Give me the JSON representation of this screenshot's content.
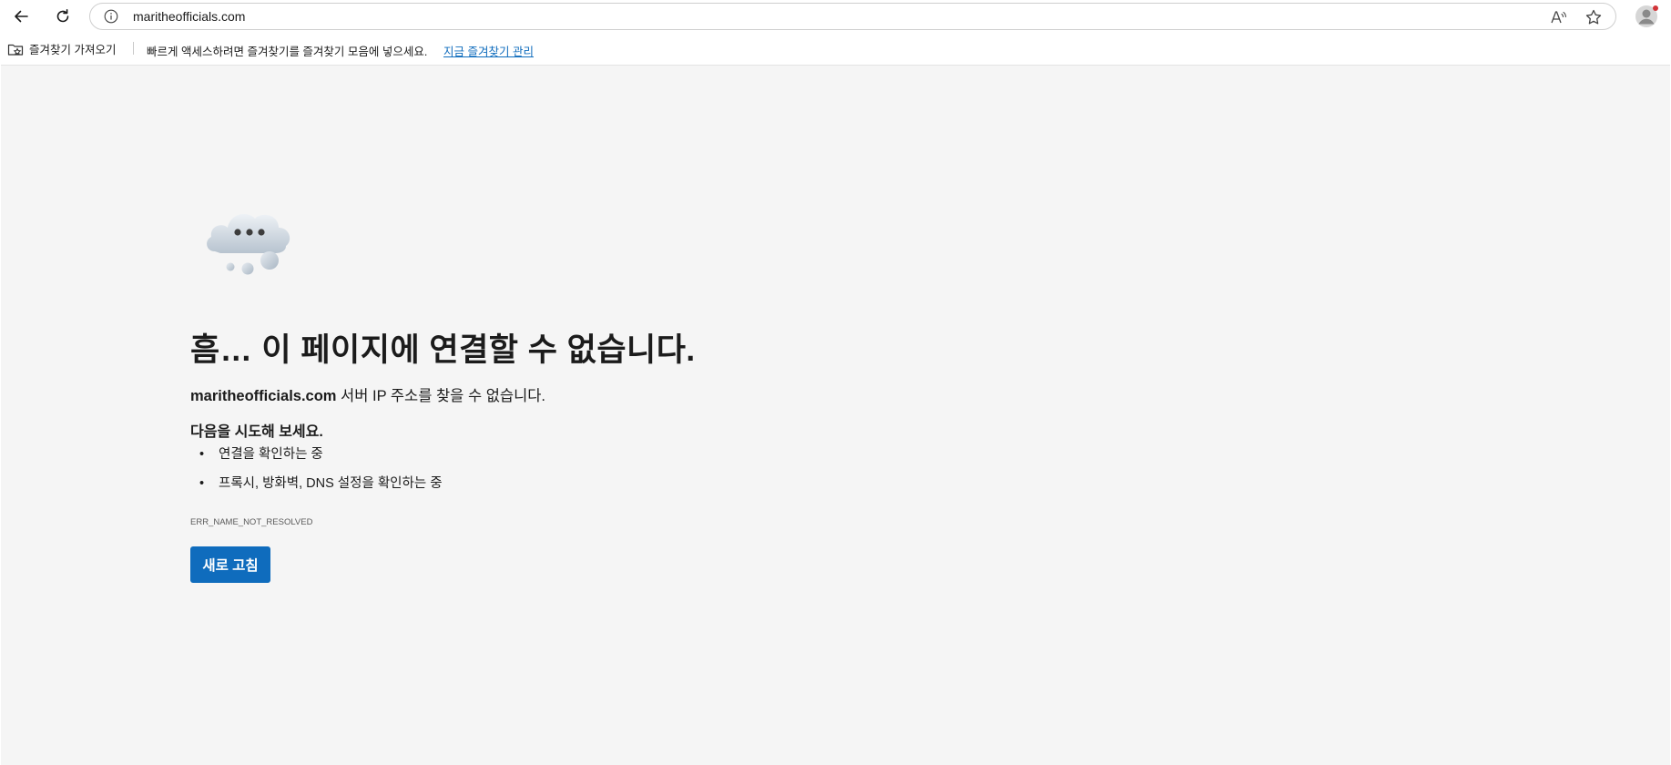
{
  "toolbar": {
    "url": "maritheofficials.com"
  },
  "favorites_bar": {
    "import_label": "즐겨찾기 가져오기",
    "prompt": "빠르게 액세스하려면 즐겨찾기를 즐겨찾기 모음에 넣으세요.",
    "manage_link": "지금 즐겨찾기 관리"
  },
  "error_page": {
    "title": "흠… 이 페이지에 연결할 수 없습니다.",
    "description_host": "maritheofficials.com",
    "description_rest": " 서버 IP 주소를 찾을 수 없습니다.",
    "try_heading": "다음을 시도해 보세요.",
    "suggestions": [
      "연결을 확인하는 중",
      "프록시, 방화벽, DNS 설정을 확인하는 중"
    ],
    "error_code": "ERR_NAME_NOT_RESOLVED",
    "refresh_button": "새로 고침"
  },
  "colors": {
    "accent": "#0f6cbd",
    "page_background": "#f5f5f5",
    "notification_dot": "#d13438"
  },
  "icons": {
    "back": "back-arrow-icon",
    "refresh": "refresh-icon",
    "info": "info-icon",
    "read_aloud": "read-aloud-icon",
    "favorite": "star-icon",
    "profile": "profile-avatar-icon",
    "import_favorites": "import-favorites-icon",
    "error_illustration": "cloud-illustration"
  }
}
